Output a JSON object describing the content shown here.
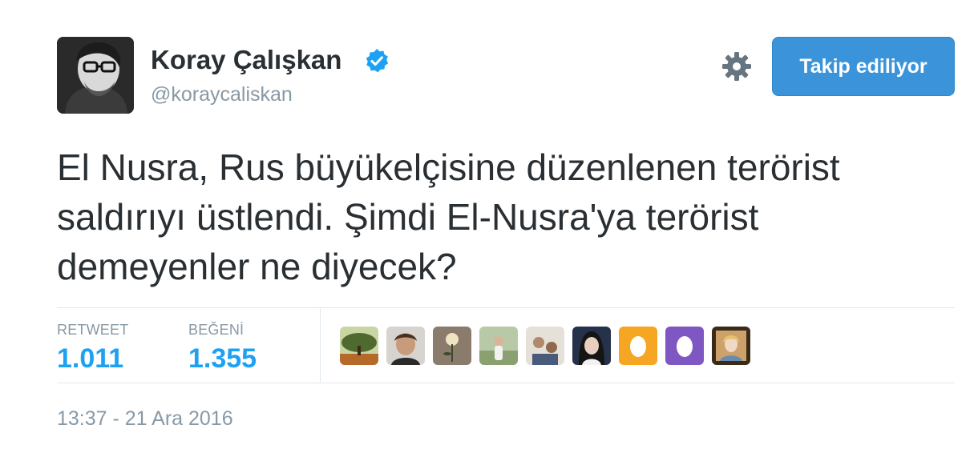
{
  "user": {
    "display_name": "Koray Çalışkan",
    "handle": "@koraycaliskan",
    "verified": true
  },
  "header": {
    "follow_button_label": "Takip ediliyor"
  },
  "tweet": {
    "text_lines": [
      "El Nusra, Rus büyükelçisine düzenlenen terörist",
      "saldırıyı üstlendi. Şimdi El-Nusra'ya terörist",
      "demeyenler ne diyecek?"
    ],
    "timestamp": "13:37 - 21 Ara 2016"
  },
  "stats": {
    "retweets": {
      "label": "RETWEET",
      "value": "1.011"
    },
    "likes": {
      "label": "BEĞENİ",
      "value": "1.355"
    }
  },
  "likers": [
    {
      "icon": "tree-photo-avatar"
    },
    {
      "icon": "person-photo-avatar"
    },
    {
      "icon": "flower-photo-avatar"
    },
    {
      "icon": "outdoor-person-avatar"
    },
    {
      "icon": "group-photo-avatar"
    },
    {
      "icon": "woman-photo-avatar"
    },
    {
      "icon": "default-egg-avatar"
    },
    {
      "icon": "default-egg-avatar"
    },
    {
      "icon": "framed-portrait-avatar"
    }
  ],
  "colors": {
    "accent": "#1da1f2",
    "follow_button": "#3b94d9",
    "muted_text": "#8899a6",
    "body_text": "#292f33",
    "divider": "#e1e8ed",
    "egg_orange": "#f5a623",
    "egg_purple": "#7e57c2"
  }
}
